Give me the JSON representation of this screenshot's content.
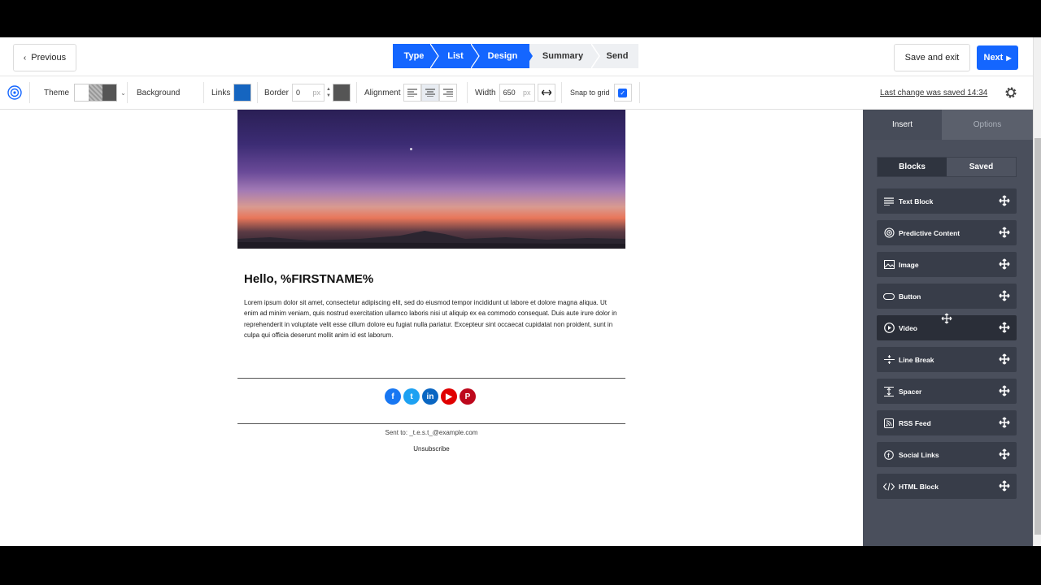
{
  "header": {
    "previous_label": "Previous",
    "steps": [
      {
        "label": "Type",
        "active": true
      },
      {
        "label": "List",
        "active": true
      },
      {
        "label": "Design",
        "active": true
      },
      {
        "label": "Summary",
        "active": false
      },
      {
        "label": "Send",
        "active": false
      }
    ],
    "save_exit_label": "Save and exit",
    "next_label": "Next"
  },
  "toolbar": {
    "theme_label": "Theme",
    "background_label": "Background",
    "links_label": "Links",
    "links_color": "#1565c0",
    "border_label": "Border",
    "border_value": "0",
    "border_unit": "px",
    "border_color": "#555555",
    "alignment_label": "Alignment",
    "width_label": "Width",
    "width_value": "650",
    "width_unit": "px",
    "snap_label": "Snap to grid",
    "snap_checked": true,
    "last_saved": "Last change was saved 14:34"
  },
  "email": {
    "greeting": "Hello, %FIRSTNAME%",
    "body": "Lorem ipsum dolor sit amet, consectetur adipiscing elit, sed do eiusmod tempor incididunt ut labore et dolore magna aliqua. Ut enim ad minim veniam, quis nostrud exercitation ullamco laboris nisi ut aliquip ex ea commodo consequat. Duis aute irure dolor in reprehenderit in voluptate velit esse cillum dolore eu fugiat nulla pariatur. Excepteur sint occaecat cupidatat non proident, sunt in culpa qui officia deserunt mollit anim id est laborum.",
    "socials": [
      {
        "name": "facebook-icon",
        "color": "#1877f2",
        "glyph": "f"
      },
      {
        "name": "twitter-icon",
        "color": "#1da1f2",
        "glyph": "t"
      },
      {
        "name": "linkedin-icon",
        "color": "#0a66c2",
        "glyph": "in"
      },
      {
        "name": "youtube-icon",
        "color": "#e00000",
        "glyph": "▶"
      },
      {
        "name": "pinterest-icon",
        "color": "#bd081c",
        "glyph": "P"
      }
    ],
    "sent_to": "Sent to: _t.e.s.t_@example.com",
    "unsubscribe": "Unsubscribe"
  },
  "panel": {
    "tab_insert": "Insert",
    "tab_options": "Options",
    "subtab_blocks": "Blocks",
    "subtab_saved": "Saved",
    "blocks": [
      {
        "label": "Text Block",
        "icon": "text-lines-icon"
      },
      {
        "label": "Predictive Content",
        "icon": "target-icon"
      },
      {
        "label": "Image",
        "icon": "image-icon"
      },
      {
        "label": "Button",
        "icon": "button-pill-icon"
      },
      {
        "label": "Video",
        "icon": "play-circle-icon"
      },
      {
        "label": "Line Break",
        "icon": "line-break-icon"
      },
      {
        "label": "Spacer",
        "icon": "spacer-icon"
      },
      {
        "label": "RSS Feed",
        "icon": "rss-icon"
      },
      {
        "label": "Social Links",
        "icon": "social-icon"
      },
      {
        "label": "HTML Block",
        "icon": "code-icon"
      }
    ]
  }
}
